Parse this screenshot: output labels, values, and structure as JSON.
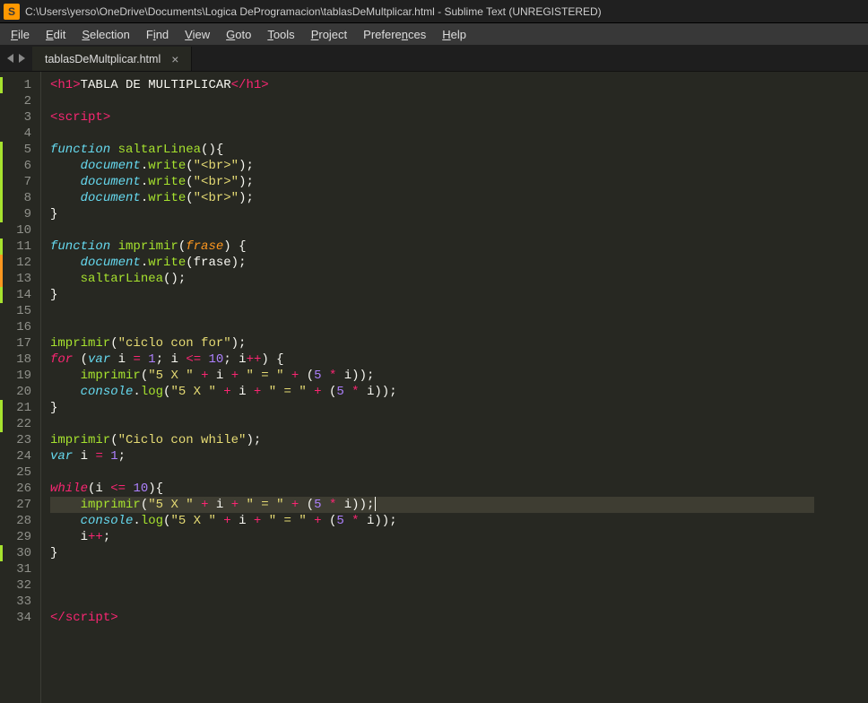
{
  "window": {
    "title": "C:\\Users\\yerso\\OneDrive\\Documents\\Logica DeProgramacion\\tablasDeMultplicar.html - Sublime Text (UNREGISTERED)",
    "app_icon_letter": "S"
  },
  "menubar": {
    "file": "File",
    "edit": "Edit",
    "selection": "Selection",
    "find": "Find",
    "view": "View",
    "goto": "Goto",
    "tools": "Tools",
    "project": "Project",
    "preferences": "Preferences",
    "help": "Help"
  },
  "tab": {
    "label": "tablasDeMultplicar.html",
    "close": "×"
  },
  "editor": {
    "line_numbers": [
      "1",
      "2",
      "3",
      "4",
      "5",
      "6",
      "7",
      "8",
      "9",
      "10",
      "11",
      "12",
      "13",
      "14",
      "15",
      "16",
      "17",
      "18",
      "19",
      "20",
      "21",
      "22",
      "23",
      "24",
      "25",
      "26",
      "27",
      "28",
      "29",
      "30",
      "31",
      "32",
      "33",
      "34"
    ],
    "selected_line": 27,
    "code_lines": [
      {
        "t": [
          {
            "c": "tag",
            "v": "<"
          },
          {
            "c": "tag",
            "v": "h1"
          },
          {
            "c": "tag",
            "v": ">"
          },
          {
            "c": "plain",
            "v": "TABLA DE MULTIPLICAR"
          },
          {
            "c": "tag",
            "v": "</"
          },
          {
            "c": "tag",
            "v": "h1"
          },
          {
            "c": "tag",
            "v": ">"
          }
        ]
      },
      {
        "t": []
      },
      {
        "t": [
          {
            "c": "tag",
            "v": "<"
          },
          {
            "c": "tag",
            "v": "script"
          },
          {
            "c": "tag",
            "v": ">"
          }
        ]
      },
      {
        "t": []
      },
      {
        "t": [
          {
            "c": "stor",
            "v": "function"
          },
          {
            "c": "plain",
            "v": " "
          },
          {
            "c": "fn",
            "v": "saltarLinea"
          },
          {
            "c": "pun",
            "v": "(){"
          }
        ]
      },
      {
        "t": [
          {
            "c": "plain",
            "v": "    "
          },
          {
            "c": "obj",
            "v": "document"
          },
          {
            "c": "pun",
            "v": "."
          },
          {
            "c": "fn",
            "v": "write"
          },
          {
            "c": "pun",
            "v": "("
          },
          {
            "c": "str",
            "v": "\"<br>\""
          },
          {
            "c": "pun",
            "v": ");"
          }
        ]
      },
      {
        "t": [
          {
            "c": "plain",
            "v": "    "
          },
          {
            "c": "obj",
            "v": "document"
          },
          {
            "c": "pun",
            "v": "."
          },
          {
            "c": "fn",
            "v": "write"
          },
          {
            "c": "pun",
            "v": "("
          },
          {
            "c": "str",
            "v": "\"<br>\""
          },
          {
            "c": "pun",
            "v": ");"
          }
        ]
      },
      {
        "t": [
          {
            "c": "plain",
            "v": "    "
          },
          {
            "c": "obj",
            "v": "document"
          },
          {
            "c": "pun",
            "v": "."
          },
          {
            "c": "fn",
            "v": "write"
          },
          {
            "c": "pun",
            "v": "("
          },
          {
            "c": "str",
            "v": "\"<br>\""
          },
          {
            "c": "pun",
            "v": ");"
          }
        ]
      },
      {
        "t": [
          {
            "c": "pun",
            "v": "}"
          }
        ]
      },
      {
        "t": []
      },
      {
        "t": [
          {
            "c": "stor",
            "v": "function"
          },
          {
            "c": "plain",
            "v": " "
          },
          {
            "c": "fn",
            "v": "imprimir"
          },
          {
            "c": "pun",
            "v": "("
          },
          {
            "c": "param",
            "v": "frase"
          },
          {
            "c": "pun",
            "v": ") {"
          }
        ]
      },
      {
        "t": [
          {
            "c": "plain",
            "v": "    "
          },
          {
            "c": "obj",
            "v": "document"
          },
          {
            "c": "pun",
            "v": "."
          },
          {
            "c": "fn",
            "v": "write"
          },
          {
            "c": "pun",
            "v": "("
          },
          {
            "c": "plain",
            "v": "frase"
          },
          {
            "c": "pun",
            "v": ");"
          }
        ]
      },
      {
        "t": [
          {
            "c": "plain",
            "v": "    "
          },
          {
            "c": "fn",
            "v": "saltarLinea"
          },
          {
            "c": "pun",
            "v": "();"
          }
        ]
      },
      {
        "t": [
          {
            "c": "pun",
            "v": "}"
          }
        ]
      },
      {
        "t": []
      },
      {
        "t": []
      },
      {
        "t": [
          {
            "c": "fn",
            "v": "imprimir"
          },
          {
            "c": "pun",
            "v": "("
          },
          {
            "c": "str",
            "v": "\"ciclo con for\""
          },
          {
            "c": "pun",
            "v": ");"
          }
        ]
      },
      {
        "t": [
          {
            "c": "kw",
            "v": "for"
          },
          {
            "c": "plain",
            "v": " "
          },
          {
            "c": "pun",
            "v": "("
          },
          {
            "c": "stor",
            "v": "var"
          },
          {
            "c": "plain",
            "v": " i "
          },
          {
            "c": "op",
            "v": "="
          },
          {
            "c": "plain",
            "v": " "
          },
          {
            "c": "num",
            "v": "1"
          },
          {
            "c": "pun",
            "v": "; "
          },
          {
            "c": "plain",
            "v": "i "
          },
          {
            "c": "op",
            "v": "<="
          },
          {
            "c": "plain",
            "v": " "
          },
          {
            "c": "num",
            "v": "10"
          },
          {
            "c": "pun",
            "v": "; "
          },
          {
            "c": "plain",
            "v": "i"
          },
          {
            "c": "op",
            "v": "++"
          },
          {
            "c": "pun",
            "v": ") {"
          }
        ]
      },
      {
        "t": [
          {
            "c": "plain",
            "v": "    "
          },
          {
            "c": "fn",
            "v": "imprimir"
          },
          {
            "c": "pun",
            "v": "("
          },
          {
            "c": "str",
            "v": "\"5 X \""
          },
          {
            "c": "plain",
            "v": " "
          },
          {
            "c": "op",
            "v": "+"
          },
          {
            "c": "plain",
            "v": " i "
          },
          {
            "c": "op",
            "v": "+"
          },
          {
            "c": "plain",
            "v": " "
          },
          {
            "c": "str",
            "v": "\" = \""
          },
          {
            "c": "plain",
            "v": " "
          },
          {
            "c": "op",
            "v": "+"
          },
          {
            "c": "plain",
            "v": " "
          },
          {
            "c": "pun",
            "v": "("
          },
          {
            "c": "num",
            "v": "5"
          },
          {
            "c": "plain",
            "v": " "
          },
          {
            "c": "op",
            "v": "*"
          },
          {
            "c": "plain",
            "v": " i"
          },
          {
            "c": "pun",
            "v": "));"
          }
        ]
      },
      {
        "t": [
          {
            "c": "plain",
            "v": "    "
          },
          {
            "c": "obj",
            "v": "console"
          },
          {
            "c": "pun",
            "v": "."
          },
          {
            "c": "fn",
            "v": "log"
          },
          {
            "c": "pun",
            "v": "("
          },
          {
            "c": "str",
            "v": "\"5 X \""
          },
          {
            "c": "plain",
            "v": " "
          },
          {
            "c": "op",
            "v": "+"
          },
          {
            "c": "plain",
            "v": " i "
          },
          {
            "c": "op",
            "v": "+"
          },
          {
            "c": "plain",
            "v": " "
          },
          {
            "c": "str",
            "v": "\" = \""
          },
          {
            "c": "plain",
            "v": " "
          },
          {
            "c": "op",
            "v": "+"
          },
          {
            "c": "plain",
            "v": " "
          },
          {
            "c": "pun",
            "v": "("
          },
          {
            "c": "num",
            "v": "5"
          },
          {
            "c": "plain",
            "v": " "
          },
          {
            "c": "op",
            "v": "*"
          },
          {
            "c": "plain",
            "v": " i"
          },
          {
            "c": "pun",
            "v": "));"
          }
        ]
      },
      {
        "t": [
          {
            "c": "pun",
            "v": "}"
          }
        ]
      },
      {
        "t": []
      },
      {
        "t": [
          {
            "c": "fn",
            "v": "imprimir"
          },
          {
            "c": "pun",
            "v": "("
          },
          {
            "c": "str",
            "v": "\"Ciclo con while\""
          },
          {
            "c": "pun",
            "v": ");"
          }
        ]
      },
      {
        "t": [
          {
            "c": "stor",
            "v": "var"
          },
          {
            "c": "plain",
            "v": " i "
          },
          {
            "c": "op",
            "v": "="
          },
          {
            "c": "plain",
            "v": " "
          },
          {
            "c": "num",
            "v": "1"
          },
          {
            "c": "pun",
            "v": ";"
          }
        ]
      },
      {
        "t": []
      },
      {
        "t": [
          {
            "c": "kw",
            "v": "while"
          },
          {
            "c": "pun",
            "v": "("
          },
          {
            "c": "plain",
            "v": "i "
          },
          {
            "c": "op",
            "v": "<="
          },
          {
            "c": "plain",
            "v": " "
          },
          {
            "c": "num",
            "v": "10"
          },
          {
            "c": "pun",
            "v": "){"
          }
        ]
      },
      {
        "t": [
          {
            "c": "plain",
            "v": "    "
          },
          {
            "c": "fn",
            "v": "imprimir"
          },
          {
            "c": "pun",
            "v": "("
          },
          {
            "c": "str",
            "v": "\"5 X \""
          },
          {
            "c": "plain",
            "v": " "
          },
          {
            "c": "op",
            "v": "+"
          },
          {
            "c": "plain",
            "v": " i "
          },
          {
            "c": "op",
            "v": "+"
          },
          {
            "c": "plain",
            "v": " "
          },
          {
            "c": "str",
            "v": "\" = \""
          },
          {
            "c": "plain",
            "v": " "
          },
          {
            "c": "op",
            "v": "+"
          },
          {
            "c": "plain",
            "v": " "
          },
          {
            "c": "pun",
            "v": "("
          },
          {
            "c": "num",
            "v": "5"
          },
          {
            "c": "plain",
            "v": " "
          },
          {
            "c": "op",
            "v": "*"
          },
          {
            "c": "plain",
            "v": " i"
          },
          {
            "c": "pun",
            "v": "));"
          }
        ],
        "cursor": true
      },
      {
        "t": [
          {
            "c": "plain",
            "v": "    "
          },
          {
            "c": "obj",
            "v": "console"
          },
          {
            "c": "pun",
            "v": "."
          },
          {
            "c": "fn",
            "v": "log"
          },
          {
            "c": "pun",
            "v": "("
          },
          {
            "c": "str",
            "v": "\"5 X \""
          },
          {
            "c": "plain",
            "v": " "
          },
          {
            "c": "op",
            "v": "+"
          },
          {
            "c": "plain",
            "v": " i "
          },
          {
            "c": "op",
            "v": "+"
          },
          {
            "c": "plain",
            "v": " "
          },
          {
            "c": "str",
            "v": "\" = \""
          },
          {
            "c": "plain",
            "v": " "
          },
          {
            "c": "op",
            "v": "+"
          },
          {
            "c": "plain",
            "v": " "
          },
          {
            "c": "pun",
            "v": "("
          },
          {
            "c": "num",
            "v": "5"
          },
          {
            "c": "plain",
            "v": " "
          },
          {
            "c": "op",
            "v": "*"
          },
          {
            "c": "plain",
            "v": " i"
          },
          {
            "c": "pun",
            "v": "));"
          }
        ]
      },
      {
        "t": [
          {
            "c": "plain",
            "v": "    i"
          },
          {
            "c": "op",
            "v": "++"
          },
          {
            "c": "pun",
            "v": ";"
          }
        ]
      },
      {
        "t": [
          {
            "c": "pun",
            "v": "}"
          }
        ]
      },
      {
        "t": []
      },
      {
        "t": []
      },
      {
        "t": []
      },
      {
        "t": [
          {
            "c": "tag",
            "v": "</"
          },
          {
            "c": "tag",
            "v": "script"
          },
          {
            "c": "tag",
            "v": ">"
          }
        ]
      }
    ]
  }
}
